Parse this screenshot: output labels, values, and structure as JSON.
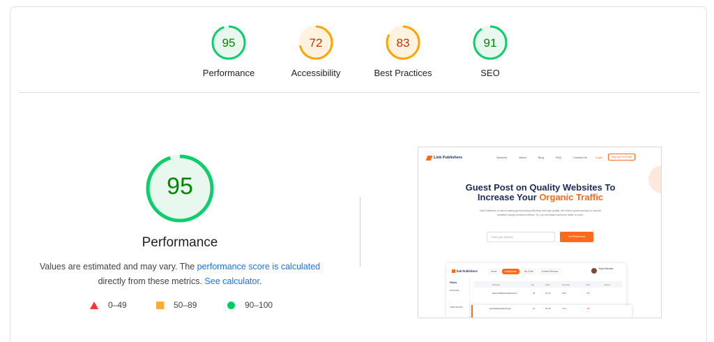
{
  "scores": [
    {
      "label": "Performance",
      "value": "95",
      "status": "pass",
      "fraction": 0.95
    },
    {
      "label": "Accessibility",
      "value": "72",
      "status": "average",
      "fraction": 0.72
    },
    {
      "label": "Best Practices",
      "value": "83",
      "status": "average",
      "fraction": 0.83
    },
    {
      "label": "SEO",
      "value": "91",
      "status": "pass",
      "fraction": 0.91
    }
  ],
  "performance": {
    "score": "95",
    "fraction": 0.95,
    "title": "Performance",
    "desc_prefix": "Values are estimated and may vary. The ",
    "desc_link1": "performance score is calculated",
    "desc_middle": " directly from these metrics. ",
    "desc_link2": "See calculator",
    "desc_suffix": "."
  },
  "legend": [
    {
      "icon": "fail-triangle-icon",
      "label": "0–49",
      "color": "#ff3333"
    },
    {
      "icon": "average-square-icon",
      "label": "50–89",
      "color": "#ffaa33"
    },
    {
      "icon": "pass-circle-icon",
      "label": "90–100",
      "color": "#00cc66"
    }
  ],
  "colors": {
    "pass": "#0cce6b",
    "pass_text": "#008800",
    "average": "#ffa400",
    "average_text": "#c33300",
    "link": "#1a73e8"
  },
  "screenshot": {
    "brand": "Link Publishers",
    "nav_links": [
      "Services",
      "About",
      "Blog",
      "FAQ",
      "Contact Us"
    ],
    "login": "Login",
    "signup": "Sign Up For Free",
    "headline_1": "Guest Post on Quality Websites To",
    "headline_2_plain": "Increase Your ",
    "headline_2_accent": "Organic Traffic",
    "paragraph": "Link Publishers is about making guest posting effortless and high quality. We ensure guest posting on only the websites having excellent metrics. So, you will attain maximum traffic for sure.",
    "input_placeholder": "Enter your Email Id",
    "cta": "Get Registered",
    "dash_brand": "link Publishers",
    "dash_tabs": [
      "Home",
      "Marketplace",
      "My Order",
      "Content Services"
    ],
    "dash_user": "Ryan Mendes",
    "dash_side": [
      "Filters",
      "DA RANGE",
      "SHOP TRAFFIC"
    ],
    "dash_headers": [
      "Websites",
      "DA",
      "Ahref",
      "Semrush",
      "Price",
      "Actions"
    ],
    "rows": [
      {
        "site": "www.architecturalview.com",
        "da": "35",
        "ahref": "61.3K",
        "semrush": "35%",
        "price": "$8"
      },
      {
        "site": "www.fashionbrand.com",
        "da": "34",
        "ahref": "55.3K",
        "semrush": "77%",
        "price": "$8"
      }
    ]
  }
}
